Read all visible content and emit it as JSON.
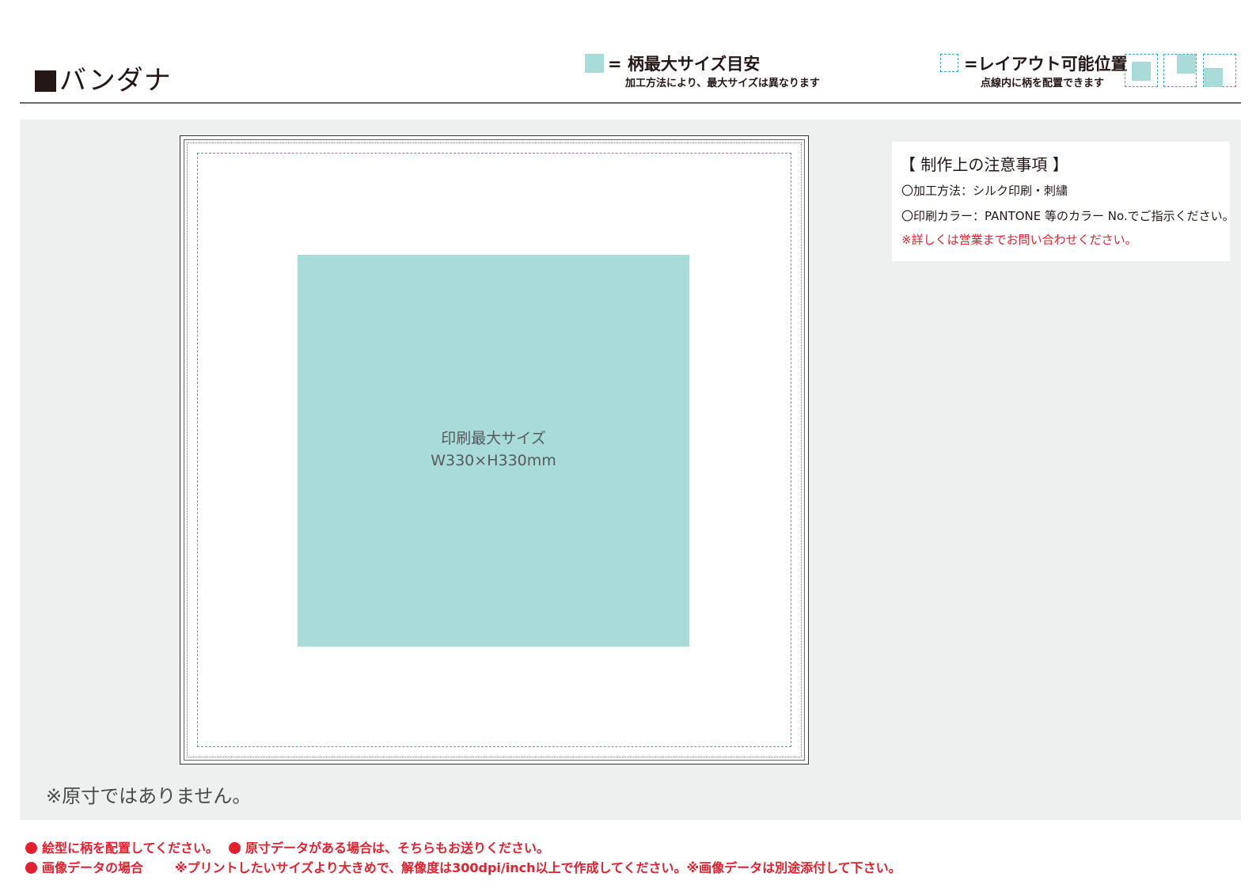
{
  "header": {
    "title": "バンダナ",
    "legend_max": {
      "title": "= 柄最大サイズ目安",
      "note": "加工方法により、最大サイズは異なります",
      "swatch_color": "#a9dbd9"
    },
    "legend_layout": {
      "title": "=レイアウト可能位置",
      "note": "点線内に柄を配置できます",
      "guide_color": "#3aa9b5"
    }
  },
  "canvas": {
    "print_area_label_1": "印刷最大サイズ",
    "print_area_label_2": "W330×H330mm",
    "print_area_color": "#a9dbd9",
    "not_actual_size": "※原寸ではありません。"
  },
  "notes": {
    "title": "【 制作上の注意事項 】",
    "line1": "〇加工方法：シルク印刷・刺繍",
    "line2": "〇印刷カラー：PANTONE 等のカラー No.でご指示ください。",
    "line3": "※詳しくは営業までお問い合わせください。"
  },
  "footer": {
    "item1": "絵型に柄を配置してください。",
    "item2": "原寸データがある場合は、そちらもお送りください。",
    "item3": "画像データの場合",
    "item3_detail": "※プリントしたいサイズより大きめで、解像度は300dpi/inch以上で作成してください。※画像データは別途添付して下さい。",
    "accent_color": "#e5202e"
  }
}
